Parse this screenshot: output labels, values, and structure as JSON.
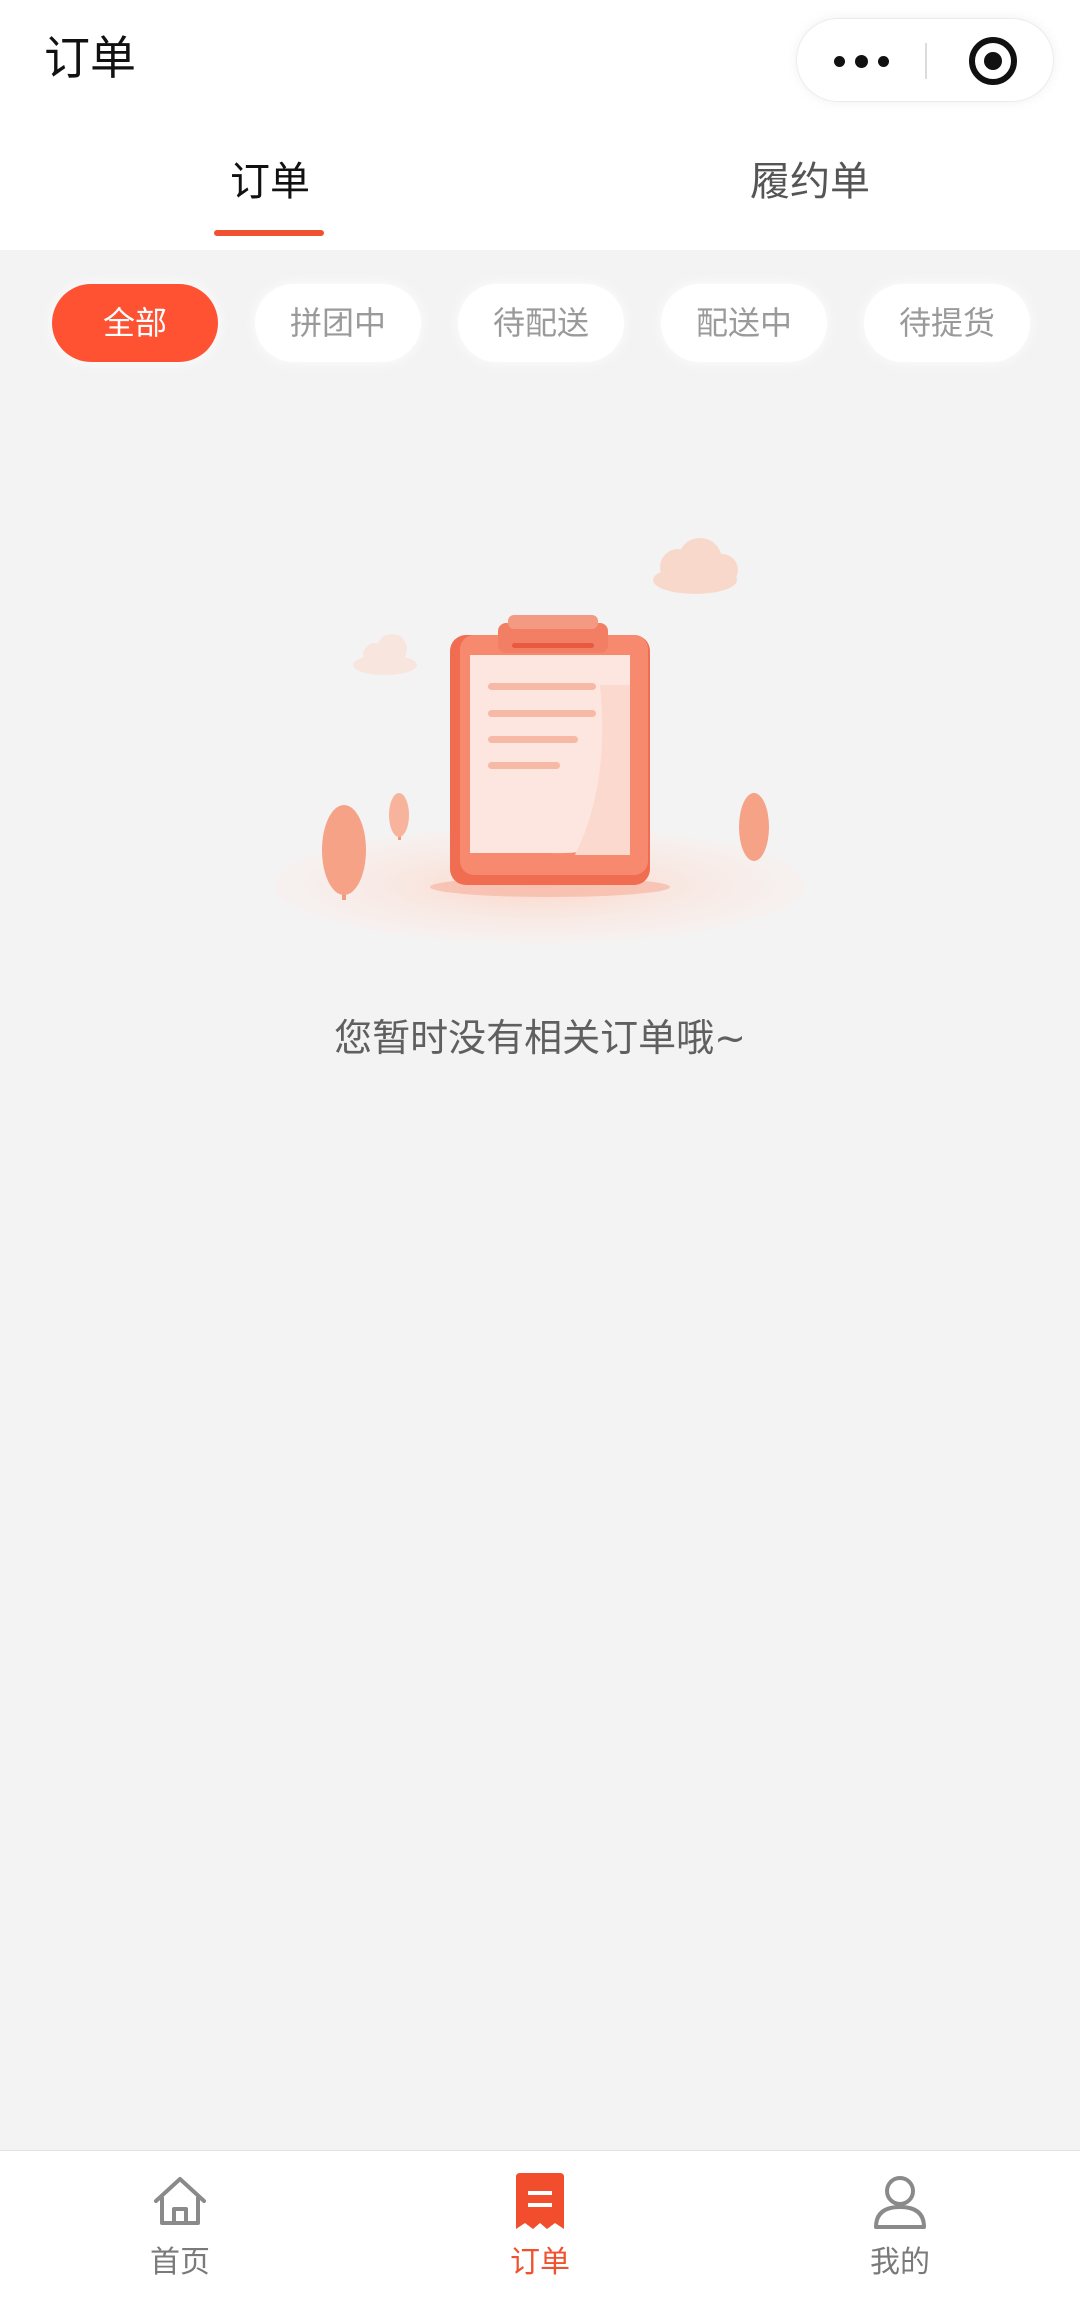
{
  "navbar": {
    "title": "订单"
  },
  "capsule": {
    "more_icon": "more-dots-icon",
    "close_icon": "target-icon"
  },
  "tabs": [
    {
      "label": "订单",
      "active": true
    },
    {
      "label": "履约单",
      "active": false
    }
  ],
  "filters": [
    {
      "label": "全部",
      "active": true
    },
    {
      "label": "拼团中",
      "active": false
    },
    {
      "label": "待配送",
      "active": false
    },
    {
      "label": "配送中",
      "active": false
    },
    {
      "label": "待提货",
      "active": false
    }
  ],
  "empty": {
    "illustration": "empty-clipboard-illustration",
    "message": "您暂时没有相关订单哦~"
  },
  "tabbar": [
    {
      "label": "首页",
      "icon": "home-icon",
      "active": false
    },
    {
      "label": "订单",
      "icon": "order-icon",
      "active": true
    },
    {
      "label": "我的",
      "icon": "user-icon",
      "active": false
    }
  ],
  "colors": {
    "accent": "#fe5233",
    "background": "#f3f3f4",
    "text_muted": "#9a9a9a"
  }
}
